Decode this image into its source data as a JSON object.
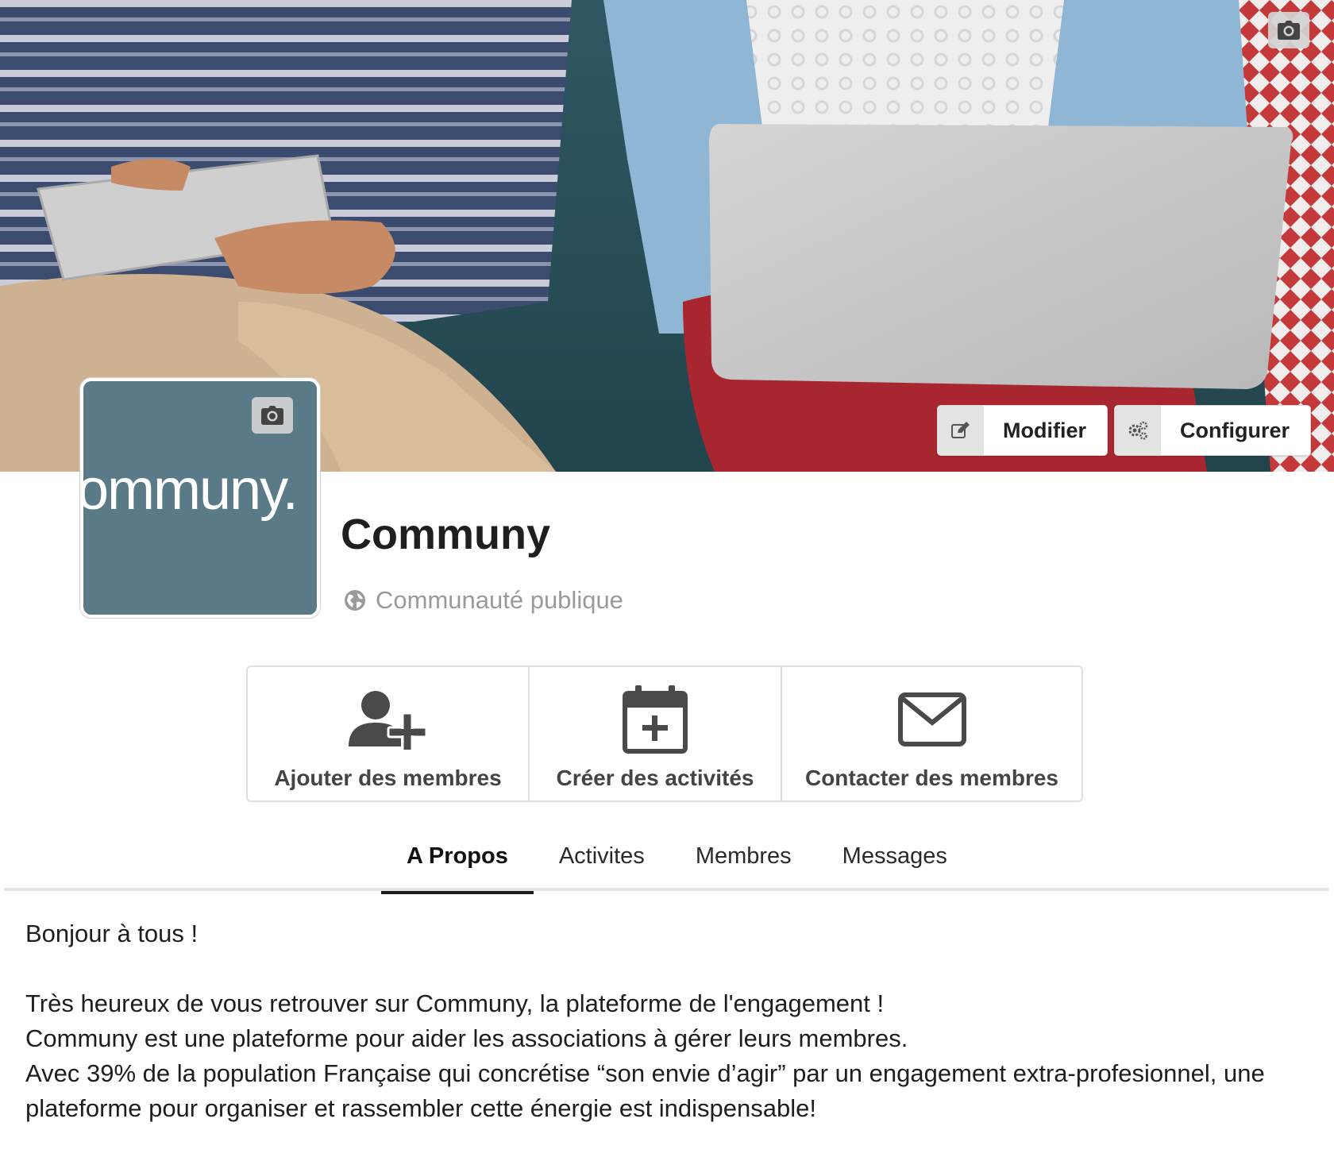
{
  "cover": {
    "actions": [
      {
        "label": "Modifier",
        "icon": "edit-icon"
      },
      {
        "label": "Configurer",
        "icon": "gears-icon"
      }
    ]
  },
  "community": {
    "name": "Communy",
    "privacy": "Communauté publique",
    "logo_text": "ommuny."
  },
  "quick_actions": [
    {
      "label": "Ajouter des membres",
      "icon": "add-user-icon"
    },
    {
      "label": "Créer des activités",
      "icon": "calendar-plus-icon"
    },
    {
      "label": "Contacter des membres",
      "icon": "envelope-icon"
    }
  ],
  "tabs": [
    {
      "label": "A Propos",
      "active": true
    },
    {
      "label": "Activites",
      "active": false
    },
    {
      "label": "Membres",
      "active": false
    },
    {
      "label": "Messages",
      "active": false
    }
  ],
  "about": {
    "greeting": "Bonjour à tous !",
    "lines": [
      "Très heureux de vous retrouver sur Communy, la plateforme de l'engagement !",
      "Communy est une plateforme pour aider les associations à gérer leurs membres.",
      "Avec 39% de la population Française qui concrétise “son envie d’agir” par un engagement extra-profesionnel, une plateforme pour organiser et rassembler cette énergie est indispensable!"
    ]
  },
  "colors": {
    "avatar_bg": "#5b7a87",
    "text_muted": "#9a9a9a",
    "border": "#dedede",
    "icon_dark": "#4a4a4a"
  }
}
